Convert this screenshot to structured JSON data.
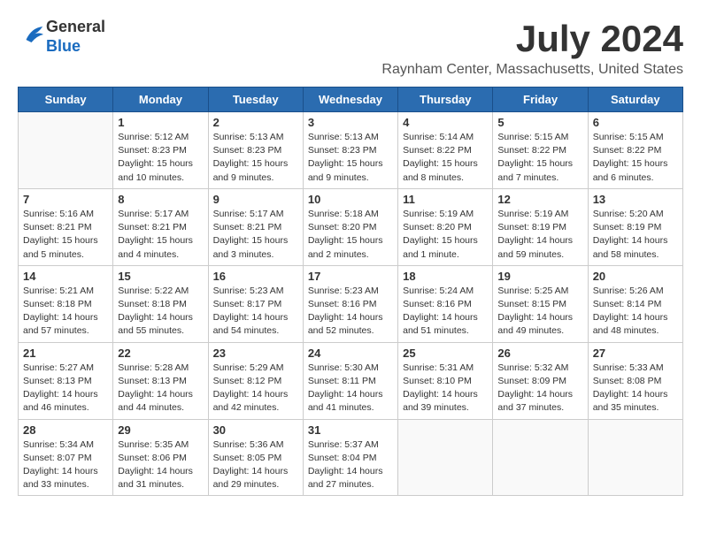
{
  "header": {
    "logo_line1": "General",
    "logo_line2": "Blue",
    "title": "July 2024",
    "subtitle": "Raynham Center, Massachusetts, United States"
  },
  "weekdays": [
    "Sunday",
    "Monday",
    "Tuesday",
    "Wednesday",
    "Thursday",
    "Friday",
    "Saturday"
  ],
  "weeks": [
    [
      {
        "day": "",
        "empty": true
      },
      {
        "day": "1",
        "sunrise": "Sunrise: 5:12 AM",
        "sunset": "Sunset: 8:23 PM",
        "daylight": "Daylight: 15 hours and 10 minutes."
      },
      {
        "day": "2",
        "sunrise": "Sunrise: 5:13 AM",
        "sunset": "Sunset: 8:23 PM",
        "daylight": "Daylight: 15 hours and 9 minutes."
      },
      {
        "day": "3",
        "sunrise": "Sunrise: 5:13 AM",
        "sunset": "Sunset: 8:23 PM",
        "daylight": "Daylight: 15 hours and 9 minutes."
      },
      {
        "day": "4",
        "sunrise": "Sunrise: 5:14 AM",
        "sunset": "Sunset: 8:22 PM",
        "daylight": "Daylight: 15 hours and 8 minutes."
      },
      {
        "day": "5",
        "sunrise": "Sunrise: 5:15 AM",
        "sunset": "Sunset: 8:22 PM",
        "daylight": "Daylight: 15 hours and 7 minutes."
      },
      {
        "day": "6",
        "sunrise": "Sunrise: 5:15 AM",
        "sunset": "Sunset: 8:22 PM",
        "daylight": "Daylight: 15 hours and 6 minutes."
      }
    ],
    [
      {
        "day": "7",
        "sunrise": "Sunrise: 5:16 AM",
        "sunset": "Sunset: 8:21 PM",
        "daylight": "Daylight: 15 hours and 5 minutes."
      },
      {
        "day": "8",
        "sunrise": "Sunrise: 5:17 AM",
        "sunset": "Sunset: 8:21 PM",
        "daylight": "Daylight: 15 hours and 4 minutes."
      },
      {
        "day": "9",
        "sunrise": "Sunrise: 5:17 AM",
        "sunset": "Sunset: 8:21 PM",
        "daylight": "Daylight: 15 hours and 3 minutes."
      },
      {
        "day": "10",
        "sunrise": "Sunrise: 5:18 AM",
        "sunset": "Sunset: 8:20 PM",
        "daylight": "Daylight: 15 hours and 2 minutes."
      },
      {
        "day": "11",
        "sunrise": "Sunrise: 5:19 AM",
        "sunset": "Sunset: 8:20 PM",
        "daylight": "Daylight: 15 hours and 1 minute."
      },
      {
        "day": "12",
        "sunrise": "Sunrise: 5:19 AM",
        "sunset": "Sunset: 8:19 PM",
        "daylight": "Daylight: 14 hours and 59 minutes."
      },
      {
        "day": "13",
        "sunrise": "Sunrise: 5:20 AM",
        "sunset": "Sunset: 8:19 PM",
        "daylight": "Daylight: 14 hours and 58 minutes."
      }
    ],
    [
      {
        "day": "14",
        "sunrise": "Sunrise: 5:21 AM",
        "sunset": "Sunset: 8:18 PM",
        "daylight": "Daylight: 14 hours and 57 minutes."
      },
      {
        "day": "15",
        "sunrise": "Sunrise: 5:22 AM",
        "sunset": "Sunset: 8:18 PM",
        "daylight": "Daylight: 14 hours and 55 minutes."
      },
      {
        "day": "16",
        "sunrise": "Sunrise: 5:23 AM",
        "sunset": "Sunset: 8:17 PM",
        "daylight": "Daylight: 14 hours and 54 minutes."
      },
      {
        "day": "17",
        "sunrise": "Sunrise: 5:23 AM",
        "sunset": "Sunset: 8:16 PM",
        "daylight": "Daylight: 14 hours and 52 minutes."
      },
      {
        "day": "18",
        "sunrise": "Sunrise: 5:24 AM",
        "sunset": "Sunset: 8:16 PM",
        "daylight": "Daylight: 14 hours and 51 minutes."
      },
      {
        "day": "19",
        "sunrise": "Sunrise: 5:25 AM",
        "sunset": "Sunset: 8:15 PM",
        "daylight": "Daylight: 14 hours and 49 minutes."
      },
      {
        "day": "20",
        "sunrise": "Sunrise: 5:26 AM",
        "sunset": "Sunset: 8:14 PM",
        "daylight": "Daylight: 14 hours and 48 minutes."
      }
    ],
    [
      {
        "day": "21",
        "sunrise": "Sunrise: 5:27 AM",
        "sunset": "Sunset: 8:13 PM",
        "daylight": "Daylight: 14 hours and 46 minutes."
      },
      {
        "day": "22",
        "sunrise": "Sunrise: 5:28 AM",
        "sunset": "Sunset: 8:13 PM",
        "daylight": "Daylight: 14 hours and 44 minutes."
      },
      {
        "day": "23",
        "sunrise": "Sunrise: 5:29 AM",
        "sunset": "Sunset: 8:12 PM",
        "daylight": "Daylight: 14 hours and 42 minutes."
      },
      {
        "day": "24",
        "sunrise": "Sunrise: 5:30 AM",
        "sunset": "Sunset: 8:11 PM",
        "daylight": "Daylight: 14 hours and 41 minutes."
      },
      {
        "day": "25",
        "sunrise": "Sunrise: 5:31 AM",
        "sunset": "Sunset: 8:10 PM",
        "daylight": "Daylight: 14 hours and 39 minutes."
      },
      {
        "day": "26",
        "sunrise": "Sunrise: 5:32 AM",
        "sunset": "Sunset: 8:09 PM",
        "daylight": "Daylight: 14 hours and 37 minutes."
      },
      {
        "day": "27",
        "sunrise": "Sunrise: 5:33 AM",
        "sunset": "Sunset: 8:08 PM",
        "daylight": "Daylight: 14 hours and 35 minutes."
      }
    ],
    [
      {
        "day": "28",
        "sunrise": "Sunrise: 5:34 AM",
        "sunset": "Sunset: 8:07 PM",
        "daylight": "Daylight: 14 hours and 33 minutes."
      },
      {
        "day": "29",
        "sunrise": "Sunrise: 5:35 AM",
        "sunset": "Sunset: 8:06 PM",
        "daylight": "Daylight: 14 hours and 31 minutes."
      },
      {
        "day": "30",
        "sunrise": "Sunrise: 5:36 AM",
        "sunset": "Sunset: 8:05 PM",
        "daylight": "Daylight: 14 hours and 29 minutes."
      },
      {
        "day": "31",
        "sunrise": "Sunrise: 5:37 AM",
        "sunset": "Sunset: 8:04 PM",
        "daylight": "Daylight: 14 hours and 27 minutes."
      },
      {
        "day": "",
        "empty": true
      },
      {
        "day": "",
        "empty": true
      },
      {
        "day": "",
        "empty": true
      }
    ]
  ]
}
